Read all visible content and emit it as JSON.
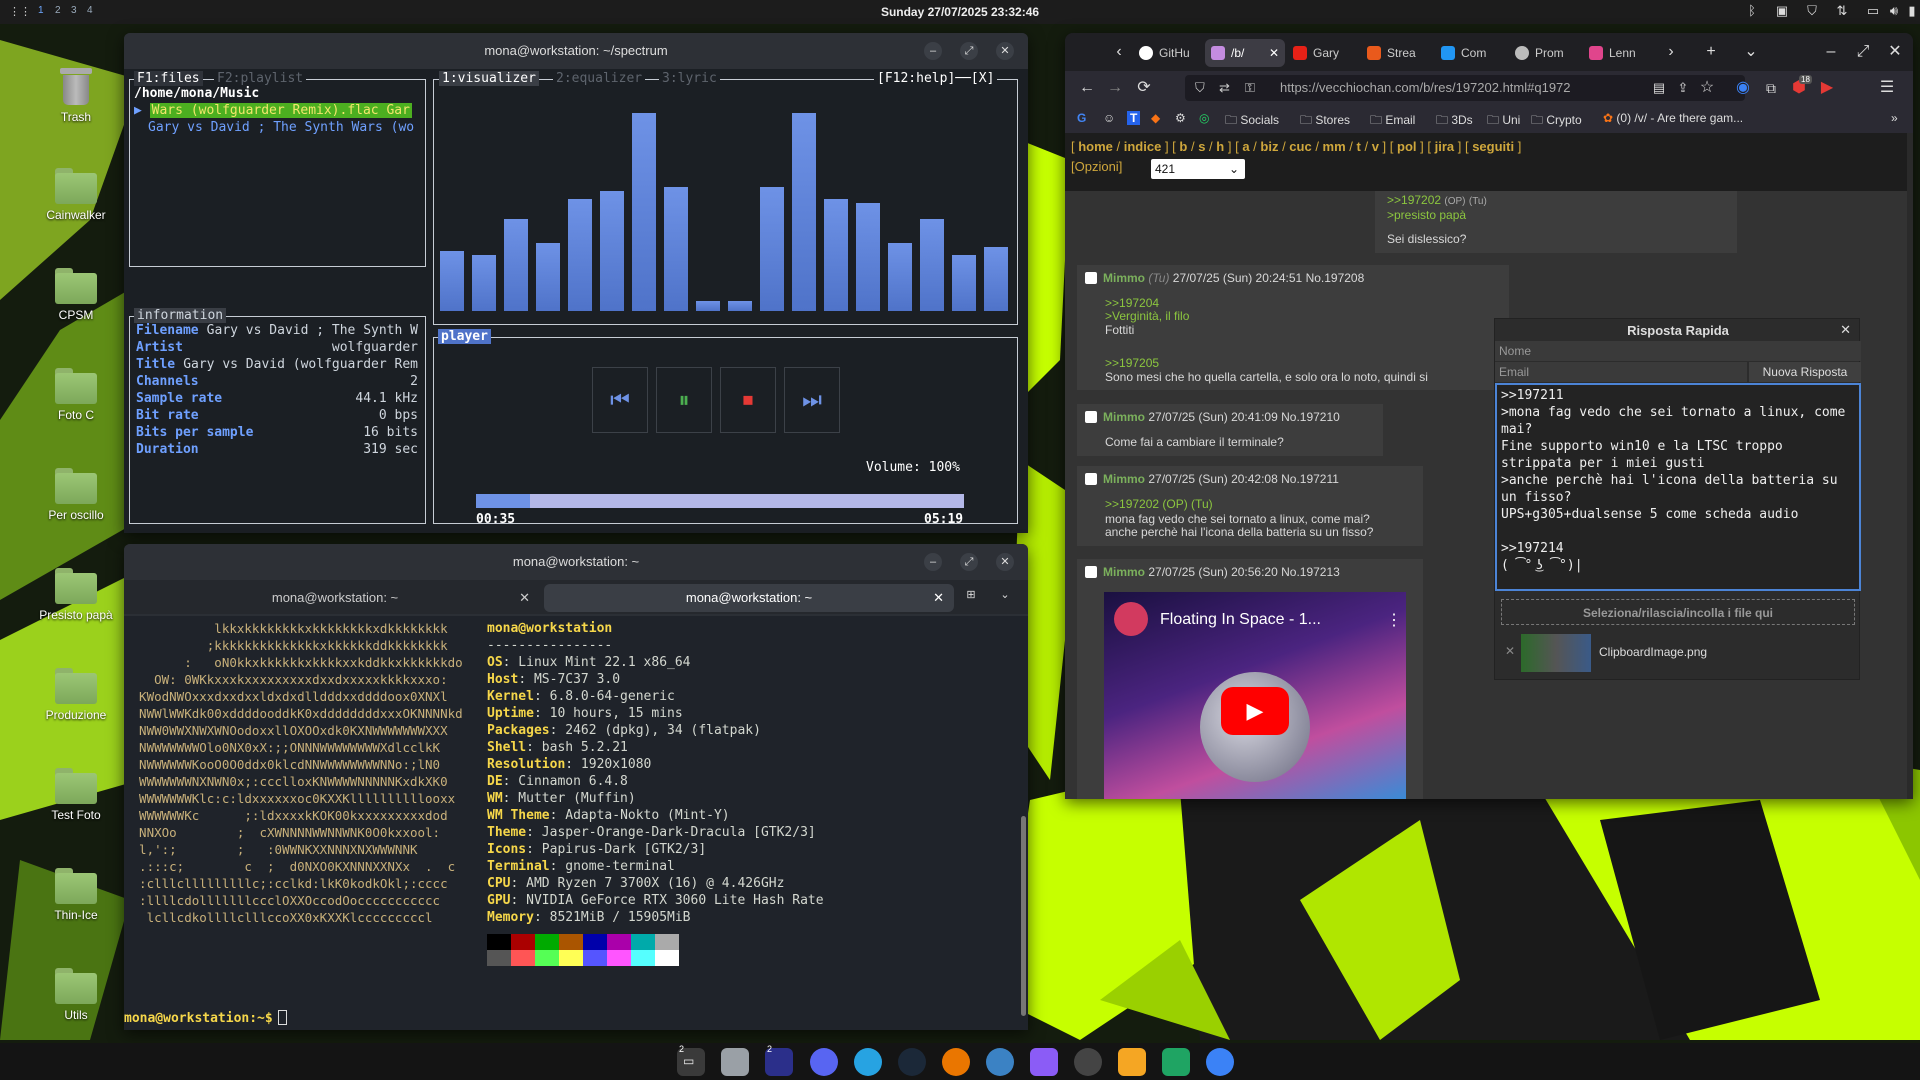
{
  "topbar": {
    "workspaces": [
      "1",
      "2",
      "3",
      "4"
    ],
    "clock": "Sunday 27/07/2025 23:32:46"
  },
  "desktop_icons": [
    "Trash",
    "Cainwalker",
    "CPSM",
    "Foto C",
    "Per oscillo",
    "Presisto papà",
    "Produzione",
    "Test Foto",
    "Thin-Ice",
    "Utils"
  ],
  "spectrum": {
    "title": "mona@workstation: ~/spectrum",
    "tab_files": "F1:files",
    "tab_playlist": "F2:playlist",
    "path": "/home/mona/Music",
    "files": [
      "Wars (wolfguarder Remix).flac Gar",
      "Gary vs David ; The Synth Wars (wo"
    ],
    "tab_visualizer": "1:visualizer",
    "tab_equalizer": "2:equalizer",
    "tab_lyric": "3:lyric",
    "help": "[F12:help]──[X]",
    "info_label": "information",
    "info": [
      {
        "k": "Filename",
        "v": "Gary vs David ; The Synth W"
      },
      {
        "k": "Artist",
        "v": "wolfguarder"
      },
      {
        "k": "Title",
        "v": "Gary vs David (wolfguarder Rem"
      },
      {
        "k": "Channels",
        "v": "2"
      },
      {
        "k": "Sample rate",
        "v": "44.1 kHz"
      },
      {
        "k": "Bit rate",
        "v": "0 bps"
      },
      {
        "k": "Bits per sample",
        "v": "16 bits"
      },
      {
        "k": "Duration",
        "v": "319 sec"
      }
    ],
    "player_label": "player",
    "volume": "Volume: 100%",
    "elapsed": "00:35",
    "total": "05:19",
    "progress": 0.11,
    "visualizer_levels": [
      0.3,
      0.28,
      0.46,
      0.34,
      0.56,
      0.6,
      0.99,
      0.62,
      0.05,
      0.05,
      0.62,
      0.99,
      0.56,
      0.54,
      0.34,
      0.46,
      0.28,
      0.32
    ]
  },
  "terminal": {
    "title": "mona@workstation: ~",
    "tab1": "mona@workstation: ~",
    "tab2": "mona@workstation: ~",
    "user_host": "mona@workstation",
    "separator": "----------------",
    "facts": [
      {
        "k": "OS",
        "v": "Linux Mint 22.1 x86_64"
      },
      {
        "k": "Host",
        "v": "MS-7C37 3.0"
      },
      {
        "k": "Kernel",
        "v": "6.8.0-64-generic"
      },
      {
        "k": "Uptime",
        "v": "10 hours, 15 mins"
      },
      {
        "k": "Packages",
        "v": "2462 (dpkg), 34 (flatpak)"
      },
      {
        "k": "Shell",
        "v": "bash 5.2.21"
      },
      {
        "k": "Resolution",
        "v": "1920x1080"
      },
      {
        "k": "DE",
        "v": "Cinnamon 6.4.8"
      },
      {
        "k": "WM",
        "v": "Mutter (Muffin)"
      },
      {
        "k": "WM Theme",
        "v": "Adapta-Nokto (Mint-Y)"
      },
      {
        "k": "Theme",
        "v": "Jasper-Orange-Dark-Dracula [GTK2/3]"
      },
      {
        "k": "Icons",
        "v": "Papirus-Dark [GTK2/3]"
      },
      {
        "k": "Terminal",
        "v": "gnome-terminal"
      },
      {
        "k": "CPU",
        "v": "AMD Ryzen 7 3700X (16) @ 4.426GHz"
      },
      {
        "k": "GPU",
        "v": "NVIDIA GeForce RTX 3060 Lite Hash Rate"
      },
      {
        "k": "Memory",
        "v": "8521MiB / 15905MiB"
      }
    ],
    "prompt": "mona@workstation:~$",
    "ascii": [
      "            lkkxkkkkkkkkxkkkkkkkkxdkkkkkkkk",
      "           ;kkkkkkkkkkkkkkxkkkkkkddkkkkkkkk",
      "        :   oN0kkxkkkkkkxkkkkxxkddkkxkkkkkkdo",
      "    OW: 0WKkxxxkxxxxxxxxxdxxdxxxxxkkkkxxxo:",
      "  KWodNWOxxxdxxdxxldxdxdlldddxxddddoox0XNXl",
      "  NWWlWWKdk00xddddooddkK0xddddddddxxxOKNNNNkd",
      "  NWW0WWXNWXWNOodoxxllOXOOxdk0KXNWWWWWWWXXX",
      "  NWWWWWWWOlo0NX0xX:;;ONNNWWWWWWWWXdlcclkK",
      "  NWWWWWWKooO0O0ddx0klcdNNWWWWWWWWNNo:;lN0",
      "  WWWWWWWNXNWN0x;:ccclloxKNWWWWNNNNNKxdkXK0",
      "  WWWWWWWKlc:c:ldxxxxxxoc0KXXKllllllllllooxx",
      "  WWWWWWKc      ;:ldxxxxkKOK00kxxxxxxxxxdod",
      "  NNXOo        ;  cXWNNNNWWNNWNK0O0kxxool:",
      "  l,':;        ;   :0WWNKXXNNNXNXWWWNNK",
      "  .:::c;        c  ;  d0NXO0KXNNNXXNXx  .  c",
      "  :clllclllllllllc;:cclkd:lkK0kodkOkl;:cccc",
      "  :llllcdolllllllccclOXXOccodOoccccccccccc",
      "   lcllcdkollllclllccoXX0xKXXKlcccccccccl"
    ],
    "palette": [
      "#000000",
      "#aa0000",
      "#00aa00",
      "#aa5500",
      "#0000aa",
      "#aa00aa",
      "#00aaaa",
      "#aaaaaa",
      "#555555",
      "#ff5555",
      "#55ff55",
      "#ffff55",
      "#5555ff",
      "#ff55ff",
      "#55ffff",
      "#ffffff"
    ]
  },
  "browser": {
    "tabs": [
      "GitHu",
      "/b/",
      "Gary",
      "Strea",
      "Com",
      "Prom",
      "Lenn"
    ],
    "url": "https://vecchiochan.com/b/res/197202.html#q1972",
    "bookmarks": [
      "Socials",
      "Stores",
      "Email",
      "3Ds",
      "Uni",
      "Crypto",
      "(0) /v/ - Are there gam..."
    ],
    "extension_badge": "18",
    "board_nav": [
      "home",
      "indice",
      "b",
      "s",
      "h",
      "a",
      "biz",
      "cuc",
      "mm",
      "t",
      "v",
      "pol",
      "jira",
      "seguiti"
    ],
    "options": "[Opzioni]",
    "select_value": "421",
    "op_post": {
      "link": ">>197202",
      "op": "(OP)",
      "you": "(Tu)",
      "quote": ">presisto papà",
      "text": "Sei dislessico?"
    },
    "posts": [
      {
        "name": "Mimmo",
        "you": "(Tu)",
        "meta": "27/07/25 (Sun) 20:24:51 No.197208",
        "lines": [
          {
            "t": ">>197204",
            "c": "quote"
          },
          {
            "t": ">Verginità, il filo",
            "c": "quote"
          },
          {
            "t": "Fottiti",
            "c": ""
          },
          {
            "t": "",
            "": ""
          },
          {
            "t": ">>197205",
            "c": "quote"
          },
          {
            "t": "Sono mesi che ho quella cartella, e solo ora lo noto, quindi si",
            "c": ""
          }
        ]
      },
      {
        "name": "Mimmo",
        "you": "",
        "meta": "27/07/25 (Sun) 20:41:09 No.197210",
        "lines": [
          {
            "t": "Come fai a cambiare il terminale?",
            "c": ""
          }
        ]
      },
      {
        "name": "Mimmo",
        "you": "",
        "meta": "27/07/25 (Sun) 20:42:08 No.197211",
        "lines": [
          {
            "t": ">>197202 (OP) (Tu)",
            "c": "qlink"
          },
          {
            "t": "mona fag vedo che sei tornato a linux, come mai?",
            "c": ""
          },
          {
            "t": "anche perchè hai l'icona della batteria su un fisso?",
            "c": ""
          }
        ]
      },
      {
        "name": "Mimmo",
        "you": "",
        "meta": "27/07/25 (Sun) 20:56:20 No.197213",
        "lines": []
      }
    ],
    "video_title": "Floating In Space - 1...",
    "quick_reply": {
      "title": "Risposta Rapida",
      "name_placeholder": "Nome",
      "email_placeholder": "Email",
      "submit": "Nuova Risposta",
      "body": ">>197211\n>mona fag vedo che sei tornato a linux, come\nmai?\nFine supporto win10 e la LTSC troppo\nstrippata per i miei gusti\n>anche perchè hai l'icona della batteria su\nun fisso?\nUPS+g305+dualsense 5 come scheda audio\n\n>>197214\n( ͡° ͜ʖ ͡°)|",
      "dropzone": "Seleziona/rilascia/incolla i file qui",
      "attachment": "ClipboardImage.png"
    }
  },
  "taskbar": {
    "badge1": "2",
    "badge2": "2"
  },
  "colors": {
    "accent": "#4c84d6",
    "neon": "#c6ff00",
    "board": "#cfa73c"
  }
}
